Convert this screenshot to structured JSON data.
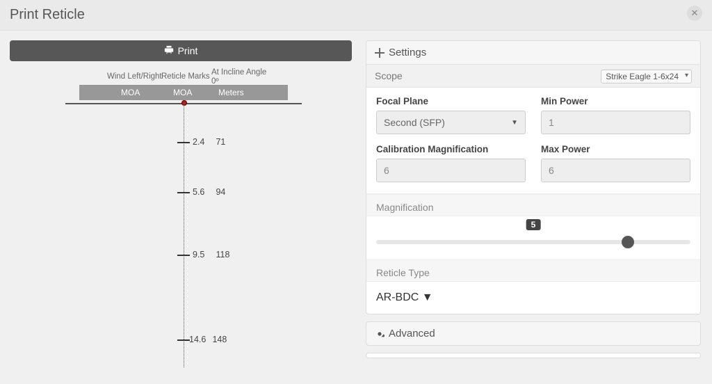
{
  "header": {
    "title": "Print Reticle"
  },
  "print_button": {
    "label": "Print"
  },
  "reticle": {
    "labels": {
      "wind": "Wind Left/Right",
      "marks": "Reticle Marks",
      "incline": "At Incline Angle",
      "incline_value": "0º"
    },
    "units": {
      "wind": "MOA",
      "marks": "MOA",
      "dist": "Meters"
    },
    "rows": [
      {
        "moa": "2.4",
        "dist": "71"
      },
      {
        "moa": "5.6",
        "dist": "94"
      },
      {
        "moa": "9.5",
        "dist": "118"
      },
      {
        "moa": "14.6",
        "dist": "148"
      }
    ]
  },
  "settings": {
    "header": "Settings",
    "scope_label": "Scope",
    "scope_value": "Strike Eagle 1-6x24",
    "focal_plane": {
      "label": "Focal Plane",
      "value": "Second (SFP)"
    },
    "min_power": {
      "label": "Min Power",
      "value": "1"
    },
    "cal_mag": {
      "label": "Calibration Magnification",
      "value": "6"
    },
    "max_power": {
      "label": "Max Power",
      "value": "6"
    },
    "magnification": {
      "label": "Magnification",
      "value": "5"
    },
    "reticle_type": {
      "label": "Reticle Type",
      "value": "AR-BDC"
    },
    "advanced": "Advanced"
  }
}
